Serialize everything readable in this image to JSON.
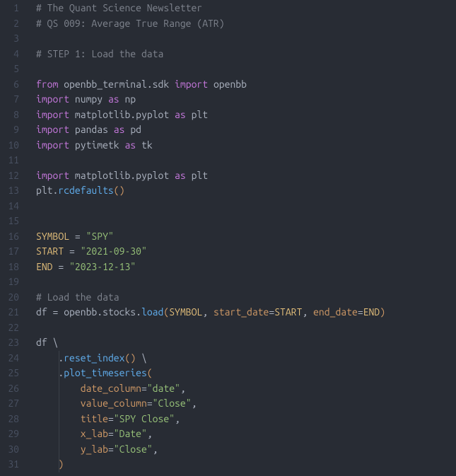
{
  "lines": [
    {
      "n": 1,
      "tokens": [
        {
          "t": "# The Quant Science Newsletter",
          "c": "c-comment"
        }
      ]
    },
    {
      "n": 2,
      "tokens": [
        {
          "t": "# QS 009: Average True Range (ATR)",
          "c": "c-comment"
        }
      ]
    },
    {
      "n": 3,
      "tokens": []
    },
    {
      "n": 4,
      "tokens": [
        {
          "t": "# STEP 1: Load the data",
          "c": "c-comment"
        }
      ]
    },
    {
      "n": 5,
      "tokens": []
    },
    {
      "n": 6,
      "tokens": [
        {
          "t": "from",
          "c": "c-keyword"
        },
        {
          "t": " ",
          "c": "c-plain"
        },
        {
          "t": "openbb_terminal",
          "c": "c-module"
        },
        {
          "t": ".",
          "c": "c-punct"
        },
        {
          "t": "sdk",
          "c": "c-module"
        },
        {
          "t": " ",
          "c": "c-plain"
        },
        {
          "t": "import",
          "c": "c-keyword"
        },
        {
          "t": " ",
          "c": "c-plain"
        },
        {
          "t": "openbb",
          "c": "c-module"
        }
      ]
    },
    {
      "n": 7,
      "tokens": [
        {
          "t": "import",
          "c": "c-keyword"
        },
        {
          "t": " ",
          "c": "c-plain"
        },
        {
          "t": "numpy",
          "c": "c-module"
        },
        {
          "t": " ",
          "c": "c-plain"
        },
        {
          "t": "as",
          "c": "c-keyword"
        },
        {
          "t": " ",
          "c": "c-plain"
        },
        {
          "t": "np",
          "c": "c-alias"
        }
      ]
    },
    {
      "n": 8,
      "tokens": [
        {
          "t": "import",
          "c": "c-keyword"
        },
        {
          "t": " ",
          "c": "c-plain"
        },
        {
          "t": "matplotlib",
          "c": "c-module"
        },
        {
          "t": ".",
          "c": "c-punct"
        },
        {
          "t": "pyplot",
          "c": "c-module"
        },
        {
          "t": " ",
          "c": "c-plain"
        },
        {
          "t": "as",
          "c": "c-keyword"
        },
        {
          "t": " ",
          "c": "c-plain"
        },
        {
          "t": "plt",
          "c": "c-alias"
        }
      ]
    },
    {
      "n": 9,
      "tokens": [
        {
          "t": "import",
          "c": "c-keyword"
        },
        {
          "t": " ",
          "c": "c-plain"
        },
        {
          "t": "pandas",
          "c": "c-module"
        },
        {
          "t": " ",
          "c": "c-plain"
        },
        {
          "t": "as",
          "c": "c-keyword"
        },
        {
          "t": " ",
          "c": "c-plain"
        },
        {
          "t": "pd",
          "c": "c-alias"
        }
      ]
    },
    {
      "n": 10,
      "tokens": [
        {
          "t": "import",
          "c": "c-keyword"
        },
        {
          "t": " ",
          "c": "c-plain"
        },
        {
          "t": "pytimetk",
          "c": "c-module"
        },
        {
          "t": " ",
          "c": "c-plain"
        },
        {
          "t": "as",
          "c": "c-keyword"
        },
        {
          "t": " ",
          "c": "c-plain"
        },
        {
          "t": "tk",
          "c": "c-alias"
        }
      ]
    },
    {
      "n": 11,
      "tokens": []
    },
    {
      "n": 12,
      "tokens": [
        {
          "t": "import",
          "c": "c-keyword"
        },
        {
          "t": " ",
          "c": "c-plain"
        },
        {
          "t": "matplotlib",
          "c": "c-module"
        },
        {
          "t": ".",
          "c": "c-punct"
        },
        {
          "t": "pyplot",
          "c": "c-module"
        },
        {
          "t": " ",
          "c": "c-plain"
        },
        {
          "t": "as",
          "c": "c-keyword"
        },
        {
          "t": " ",
          "c": "c-plain"
        },
        {
          "t": "plt",
          "c": "c-alias"
        }
      ]
    },
    {
      "n": 13,
      "tokens": [
        {
          "t": "plt",
          "c": "c-plain"
        },
        {
          "t": ".",
          "c": "c-punct"
        },
        {
          "t": "rcdefaults",
          "c": "c-func"
        },
        {
          "t": "(",
          "c": "c-bracket-y"
        },
        {
          "t": ")",
          "c": "c-bracket-y"
        }
      ]
    },
    {
      "n": 14,
      "tokens": []
    },
    {
      "n": 15,
      "tokens": []
    },
    {
      "n": 16,
      "tokens": [
        {
          "t": "SYMBOL",
          "c": "c-const"
        },
        {
          "t": " ",
          "c": "c-plain"
        },
        {
          "t": "=",
          "c": "c-op"
        },
        {
          "t": " ",
          "c": "c-plain"
        },
        {
          "t": "\"SPY\"",
          "c": "c-string"
        }
      ]
    },
    {
      "n": 17,
      "tokens": [
        {
          "t": "START",
          "c": "c-const"
        },
        {
          "t": " ",
          "c": "c-plain"
        },
        {
          "t": "=",
          "c": "c-op"
        },
        {
          "t": " ",
          "c": "c-plain"
        },
        {
          "t": "\"2021-09-30\"",
          "c": "c-string"
        }
      ]
    },
    {
      "n": 18,
      "tokens": [
        {
          "t": "END",
          "c": "c-const"
        },
        {
          "t": " ",
          "c": "c-plain"
        },
        {
          "t": "=",
          "c": "c-op"
        },
        {
          "t": " ",
          "c": "c-plain"
        },
        {
          "t": "\"2023-12-13\"",
          "c": "c-string"
        }
      ]
    },
    {
      "n": 19,
      "tokens": []
    },
    {
      "n": 20,
      "tokens": [
        {
          "t": "# Load the data",
          "c": "c-comment"
        }
      ]
    },
    {
      "n": 21,
      "tokens": [
        {
          "t": "df",
          "c": "c-plain"
        },
        {
          "t": " ",
          "c": "c-plain"
        },
        {
          "t": "=",
          "c": "c-op"
        },
        {
          "t": " ",
          "c": "c-plain"
        },
        {
          "t": "openbb",
          "c": "c-plain"
        },
        {
          "t": ".",
          "c": "c-punct"
        },
        {
          "t": "stocks",
          "c": "c-plain"
        },
        {
          "t": ".",
          "c": "c-punct"
        },
        {
          "t": "load",
          "c": "c-func"
        },
        {
          "t": "(",
          "c": "c-bracket-y"
        },
        {
          "t": "SYMBOL",
          "c": "c-const"
        },
        {
          "t": ",",
          "c": "c-punct"
        },
        {
          "t": " ",
          "c": "c-plain"
        },
        {
          "t": "start_date",
          "c": "c-param"
        },
        {
          "t": "=",
          "c": "c-op"
        },
        {
          "t": "START",
          "c": "c-const"
        },
        {
          "t": ",",
          "c": "c-punct"
        },
        {
          "t": " ",
          "c": "c-plain"
        },
        {
          "t": "end_date",
          "c": "c-param"
        },
        {
          "t": "=",
          "c": "c-op"
        },
        {
          "t": "END",
          "c": "c-const"
        },
        {
          "t": ")",
          "c": "c-bracket-y"
        }
      ]
    },
    {
      "n": 22,
      "tokens": []
    },
    {
      "n": 23,
      "tokens": [
        {
          "t": "df",
          "c": "c-plain"
        },
        {
          "t": " ",
          "c": "c-plain"
        },
        {
          "t": "\\",
          "c": "c-plain"
        }
      ]
    },
    {
      "n": 24,
      "guides": [
        32
      ],
      "tokens": [
        {
          "t": "    ",
          "c": "c-plain"
        },
        {
          "t": ".",
          "c": "c-punct"
        },
        {
          "t": "reset_index",
          "c": "c-func"
        },
        {
          "t": "(",
          "c": "c-bracket-y"
        },
        {
          "t": ")",
          "c": "c-bracket-y"
        },
        {
          "t": " ",
          "c": "c-plain"
        },
        {
          "t": "\\",
          "c": "c-plain"
        }
      ]
    },
    {
      "n": 25,
      "guides": [
        32
      ],
      "tokens": [
        {
          "t": "    ",
          "c": "c-plain"
        },
        {
          "t": ".",
          "c": "c-punct"
        },
        {
          "t": "plot_timeseries",
          "c": "c-func"
        },
        {
          "t": "(",
          "c": "c-bracket-y"
        }
      ]
    },
    {
      "n": 26,
      "guides": [
        32
      ],
      "tokens": [
        {
          "t": "        ",
          "c": "c-plain"
        },
        {
          "t": "date_column",
          "c": "c-param"
        },
        {
          "t": "=",
          "c": "c-op"
        },
        {
          "t": "\"date\"",
          "c": "c-string"
        },
        {
          "t": ",",
          "c": "c-punct"
        }
      ]
    },
    {
      "n": 27,
      "guides": [
        32
      ],
      "tokens": [
        {
          "t": "        ",
          "c": "c-plain"
        },
        {
          "t": "value_column",
          "c": "c-param"
        },
        {
          "t": "=",
          "c": "c-op"
        },
        {
          "t": "\"Close\"",
          "c": "c-string"
        },
        {
          "t": ",",
          "c": "c-punct"
        }
      ]
    },
    {
      "n": 28,
      "guides": [
        32
      ],
      "tokens": [
        {
          "t": "        ",
          "c": "c-plain"
        },
        {
          "t": "title",
          "c": "c-param"
        },
        {
          "t": "=",
          "c": "c-op"
        },
        {
          "t": "\"SPY Close\"",
          "c": "c-string"
        },
        {
          "t": ",",
          "c": "c-punct"
        }
      ]
    },
    {
      "n": 29,
      "guides": [
        32
      ],
      "tokens": [
        {
          "t": "        ",
          "c": "c-plain"
        },
        {
          "t": "x_lab",
          "c": "c-param"
        },
        {
          "t": "=",
          "c": "c-op"
        },
        {
          "t": "\"Date\"",
          "c": "c-string"
        },
        {
          "t": ",",
          "c": "c-punct"
        }
      ]
    },
    {
      "n": 30,
      "guides": [
        32
      ],
      "tokens": [
        {
          "t": "        ",
          "c": "c-plain"
        },
        {
          "t": "y_lab",
          "c": "c-param"
        },
        {
          "t": "=",
          "c": "c-op"
        },
        {
          "t": "\"Close\"",
          "c": "c-string"
        },
        {
          "t": ",",
          "c": "c-punct"
        }
      ]
    },
    {
      "n": 31,
      "guides": [
        32
      ],
      "tokens": [
        {
          "t": "    ",
          "c": "c-plain"
        },
        {
          "t": ")",
          "c": "c-bracket-y"
        }
      ]
    }
  ]
}
